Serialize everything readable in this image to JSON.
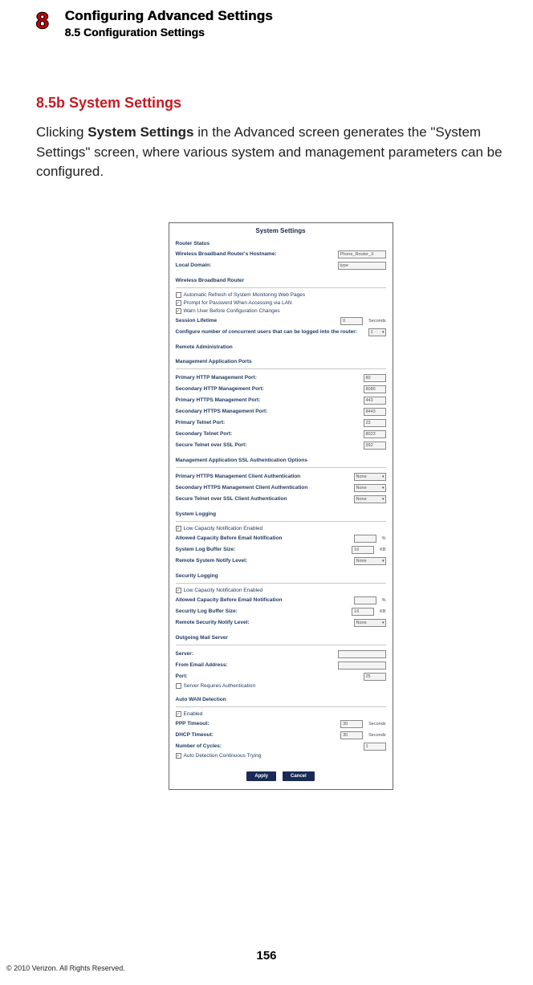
{
  "header": {
    "chapter_number": "8",
    "chapter_title": "Configuring Advanced Settings",
    "section_label": "8.5  Configuration Settings"
  },
  "content": {
    "subheading": "8.5b  System Settings",
    "para_before": "Clicking ",
    "para_bold": "System Settings",
    "para_after": " in the Advanced screen generates the \"System Settings\" screen, where various system and management parameters can be configured."
  },
  "fig": {
    "title": "System Settings",
    "router_status": {
      "heading": "Router Status",
      "hostname_label": "Wireless Broadband Router's Hostname:",
      "hostname_value": "Phone_Router_X",
      "domain_label": "Local Domain:",
      "domain_value": "type"
    },
    "wbr": {
      "heading": "Wireless Broadband Router",
      "cb1": {
        "checked": false,
        "label": "Automatic Refresh of System Monitoring Web Pages"
      },
      "cb2": {
        "checked": true,
        "label": "Prompt for Password When Accessing via LAN"
      },
      "cb3": {
        "checked": true,
        "label": "Warn User Before Configuration Changes"
      },
      "session_label": "Session Lifetime",
      "session_value": "0",
      "session_unit": "Seconds",
      "users_label": "Configure number of concurrent users that can be logged into the router:",
      "users_value": "1"
    },
    "remote_admin": "Remote Administration",
    "mgmt_ports": {
      "heading": "Management Application Ports",
      "rows": [
        {
          "label": "Primary HTTP Management Port:",
          "value": "80"
        },
        {
          "label": "Secondary HTTP Management Port:",
          "value": "8080"
        },
        {
          "label": "Primary HTTPS Management Port:",
          "value": "443"
        },
        {
          "label": "Secondary HTTPS Management Port:",
          "value": "8443"
        },
        {
          "label": "Primary Telnet Port:",
          "value": "23"
        },
        {
          "label": "Secondary Telnet Port:",
          "value": "8023"
        },
        {
          "label": "Secure Telnet over SSL Port:",
          "value": "992"
        }
      ]
    },
    "ssl_auth": {
      "heading": "Management Application SSL Authentication Options",
      "rows": [
        {
          "label": "Primary HTTPS Management Client Authentication",
          "value": "None"
        },
        {
          "label": "Secondary HTTPS Management Client Authentication",
          "value": "None"
        },
        {
          "label": "Secure Telnet over SSL Client Authentication",
          "value": "None"
        }
      ]
    },
    "syslog": {
      "heading": "System Logging",
      "cb": {
        "checked": true,
        "label": "Low Capacity Notification Enabled"
      },
      "cap_label": "Allowed Capacity Before Email Notification",
      "cap_value": "",
      "cap_unit": "%",
      "buf_label": "System Log Buffer Size:",
      "buf_value": "16",
      "buf_unit": "KB",
      "notify_label": "Remote System Notify Level:",
      "notify_value": "None"
    },
    "seclog": {
      "heading": "Security Logging",
      "cb": {
        "checked": true,
        "label": "Low Capacity Notification Enabled"
      },
      "cap_label": "Allowed Capacity Before Email Notification",
      "cap_value": "",
      "cap_unit": "%",
      "buf_label": "Security Log Buffer Size:",
      "buf_value": "16",
      "buf_unit": "KB",
      "notify_label": "Remote Security Notify Level:",
      "notify_value": "None"
    },
    "mail": {
      "heading": "Outgoing Mail Server",
      "server_label": "Server:",
      "from_label": "From Email Address:",
      "port_label": "Port:",
      "port_value": "25",
      "auth_cb": {
        "checked": false,
        "label": "Server Requires Authentication"
      }
    },
    "autowan": {
      "heading": "Auto WAN Detection",
      "cb": {
        "checked": true,
        "label": "Enabled"
      },
      "ppp_label": "PPP Timeout:",
      "ppp_value": "30",
      "ppp_unit": "Seconds",
      "dhcp_label": "DHCP Timeout:",
      "dhcp_value": "30",
      "dhcp_unit": "Seconds",
      "cycles_label": "Number of Cycles:",
      "cycles_value": "1",
      "cont_cb": {
        "checked": true,
        "label": "Auto Detection Continuous Trying"
      }
    },
    "buttons": {
      "apply": "Apply",
      "cancel": "Cancel"
    }
  },
  "footer": {
    "page_number": "156",
    "copyright": "© 2010 Verizon. All Rights Reserved."
  }
}
